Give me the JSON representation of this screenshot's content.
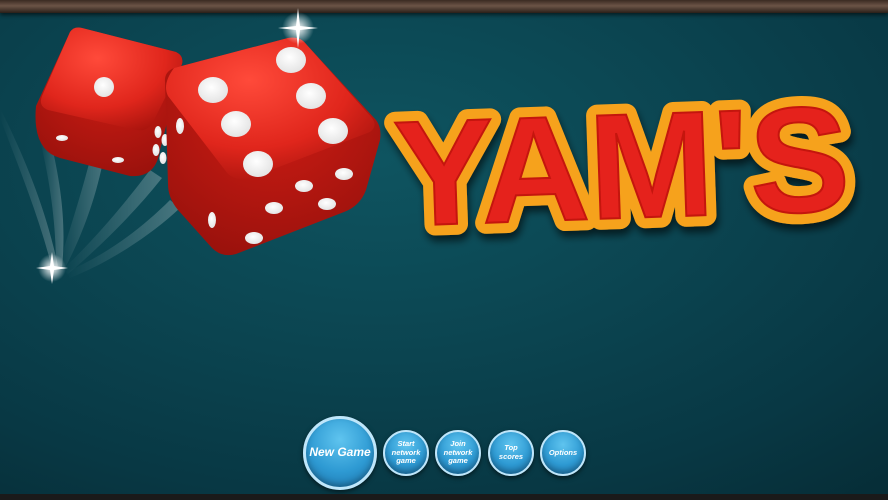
{
  "game": {
    "title": "YAM'S"
  },
  "menu": {
    "new_game": "New Game",
    "start_network_game": "Start network game",
    "join_network_game": "Join network game",
    "top_scores": "Top scores",
    "options": "Options"
  },
  "dice": [
    {
      "name": "back-die",
      "top_face_value": 1,
      "color": "#e0261c"
    },
    {
      "name": "front-die",
      "top_face_value": 5,
      "color": "#e0261c"
    }
  ],
  "colors": {
    "background": "#0b4450",
    "title_fill": "#e5201f",
    "title_outline": "#f6a21c",
    "button": "#2e9ad3",
    "button_border": "#bfe6fa"
  }
}
